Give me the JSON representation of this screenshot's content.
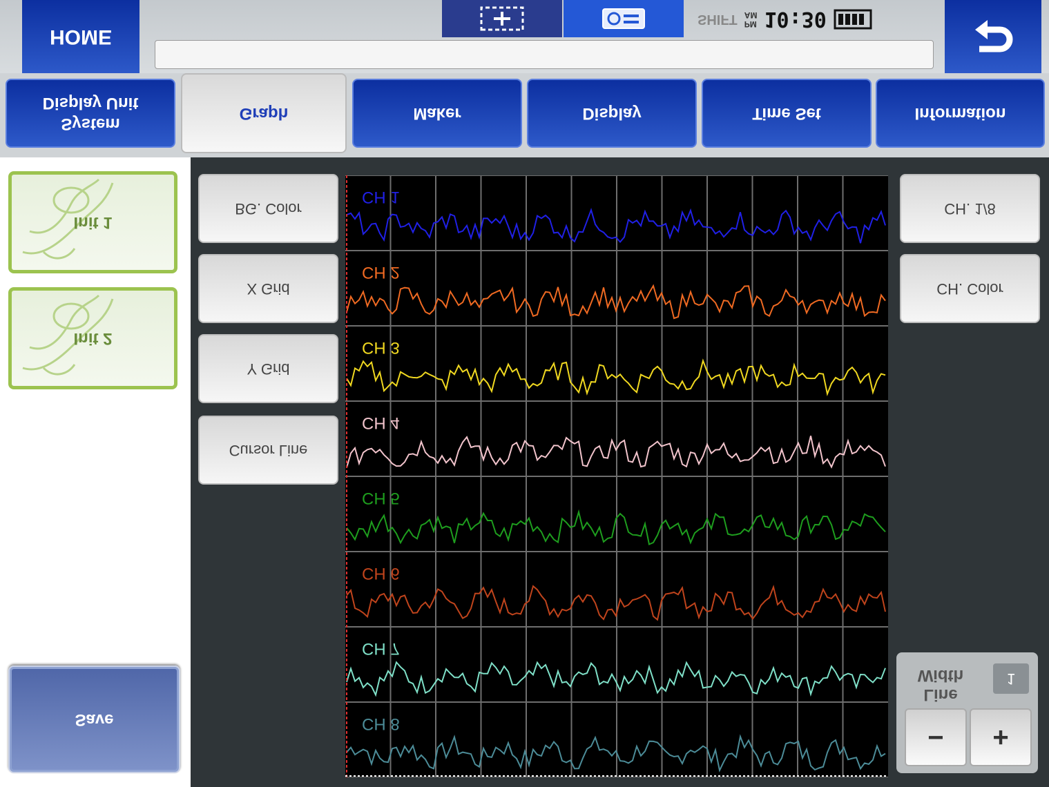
{
  "left_panel": {
    "save_label": "Save",
    "init1_label": "Init 1",
    "init2_label": "Init 2"
  },
  "graph_buttons": {
    "cursor_line": "Cursor Line",
    "y_grid": "Y Grid",
    "x_grid": "X Grid",
    "bg_color": "BG. Color"
  },
  "channel_buttons": {
    "ch_color": "CH. Color",
    "ch_select": "CH. 1/8"
  },
  "line_width": {
    "minus": "−",
    "plus": "+",
    "label": "Line\nWidth",
    "value": "1"
  },
  "channels": [
    {
      "label": "CH 8",
      "color": "#4c8c98"
    },
    {
      "label": "CH 7",
      "color": "#7fe0c8"
    },
    {
      "label": "CH 6",
      "color": "#c0441c"
    },
    {
      "label": "CH 5",
      "color": "#1e9e1e"
    },
    {
      "label": "CH 4",
      "color": "#f2c4cc"
    },
    {
      "label": "CH 3",
      "color": "#f0d820"
    },
    {
      "label": "CH 2",
      "color": "#f06a22"
    },
    {
      "label": "CH 1",
      "color": "#2020e6"
    }
  ],
  "tabs": [
    {
      "label": "System\nDisplay Unit",
      "active": false
    },
    {
      "label": "Graph",
      "active": true
    },
    {
      "label": "Maker",
      "active": false
    },
    {
      "label": "Display",
      "active": false
    },
    {
      "label": "Time Set",
      "active": false
    },
    {
      "label": "Information",
      "active": false
    }
  ],
  "status": {
    "home_label": "HOME",
    "shift_label": "SHIFT",
    "am": "AM",
    "pm": "PM",
    "time": "10:30"
  },
  "colors": {
    "accent_blue": "#1a3fb8",
    "init_green": "#9cc34f",
    "scope_bg": "#000000",
    "grid": "#6e6e6e"
  }
}
